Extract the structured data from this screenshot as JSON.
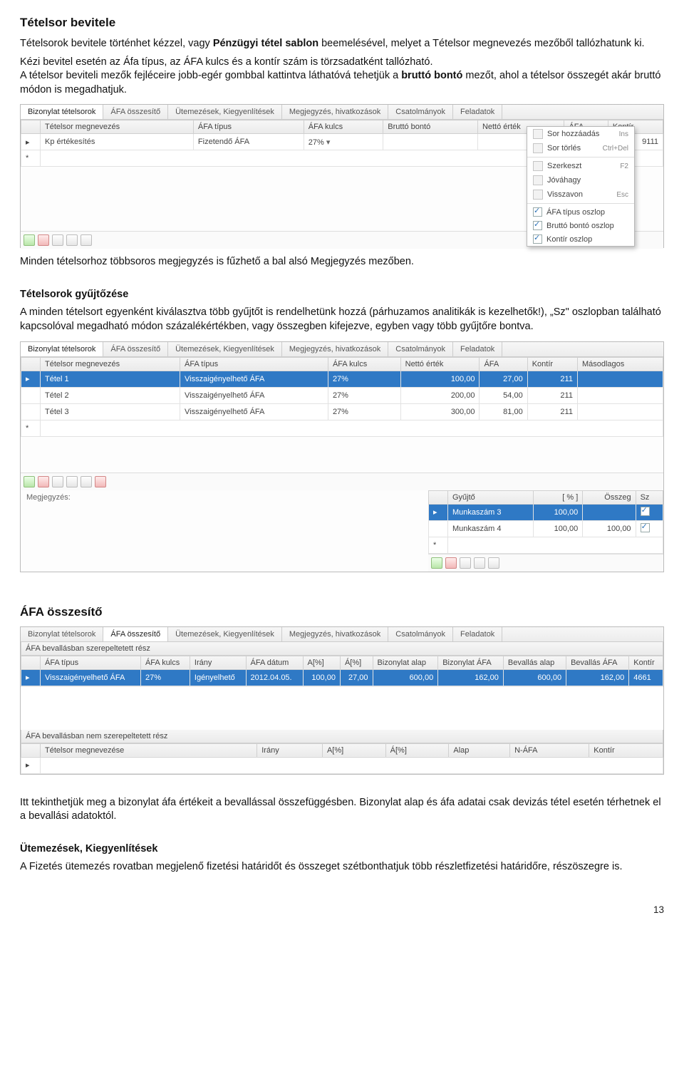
{
  "s0": {
    "h": "Tételsor bevitele",
    "p1a": "Tételsorok bevitele történhet kézzel, vagy ",
    "p1b": "Pénzügyi tétel sablon",
    "p1c": " beemelésével, melyet a Tételsor megnevezés mezőből tallózhatunk ki.",
    "p2a": "Kézi bevitel esetén az Áfa típus, az ÁFA kulcs és a kontír szám is törzsadatként tallózható.",
    "p2b": "A tételsor beviteli mezők fejléceire jobb-egér gombbal kattintva láthatóvá tehetjük a ",
    "p2c": "bruttó bontó",
    "p2d": " mezőt, ahol a tételsor összegét akár bruttó módon is megadhatjuk."
  },
  "shot1": {
    "tabs": [
      "Bizonylat tételsorok",
      "ÁFA összesítő",
      "Ütemezések, Kiegyenlítések",
      "Megjegyzés, hivatkozások",
      "Csatolmányok",
      "Feladatok"
    ],
    "cols": [
      "",
      "Tételsor megnevezés",
      "ÁFA típus",
      "ÁFA kulcs",
      "Bruttó bontó",
      "Nettó érték",
      "ÁFA",
      "Kontír"
    ],
    "row": {
      "name": "Kp értékesítés",
      "afat": "Fizetendő ÁFA",
      "kulcs": "27%",
      "kontir": "9111"
    },
    "ctx": [
      {
        "t": "Sor hozzáadás",
        "k": "Ins"
      },
      {
        "t": "Sor törlés",
        "k": "Ctrl+Del"
      },
      {
        "div": true
      },
      {
        "t": "Szerkeszt",
        "k": "F2"
      },
      {
        "t": "Jóváhagy",
        "k": ""
      },
      {
        "t": "Visszavon",
        "k": "Esc"
      },
      {
        "div": true
      },
      {
        "t": "ÁFA típus oszlop",
        "chk": true
      },
      {
        "t": "Bruttó bontó oszlop",
        "chk": true
      },
      {
        "t": "Kontír oszlop",
        "chk": true
      }
    ]
  },
  "s1": {
    "after": "Minden tételsorhoz többsoros megjegyzés is fűzhető a bal alsó Megjegyzés mezőben."
  },
  "s2": {
    "h": "Tételsorok gyűjtőzése",
    "p": "A minden tételsort egyenként kiválasztva több gyűjtőt is rendelhetünk hozzá (párhuzamos analitikák is kezelhetők!), „Sz\" oszlopban található kapcsolóval megadható módon százalékértékben, vagy összegben kifejezve, egyben vagy több gyűjtőre bontva."
  },
  "shot2": {
    "tabs": [
      "Bizonylat tételsorok",
      "ÁFA összesítő",
      "Ütemezések, Kiegyenlítések",
      "Megjegyzés, hivatkozások",
      "Csatolmányok",
      "Feladatok"
    ],
    "cols": [
      "",
      "Tételsor megnevezés",
      "ÁFA típus",
      "ÁFA kulcs",
      "Nettó érték",
      "ÁFA",
      "Kontír",
      "Másodlagos"
    ],
    "rows": [
      {
        "n": "Tétel 1",
        "t": "Visszaigényelhető ÁFA",
        "k": "27%",
        "ne": "100,00",
        "a": "27,00",
        "ko": "211",
        "sel": true
      },
      {
        "n": "Tétel 2",
        "t": "Visszaigényelhető ÁFA",
        "k": "27%",
        "ne": "200,00",
        "a": "54,00",
        "ko": "211"
      },
      {
        "n": "Tétel 3",
        "t": "Visszaigényelhető ÁFA",
        "k": "27%",
        "ne": "300,00",
        "a": "81,00",
        "ko": "211"
      }
    ],
    "meglbl": "Megjegyzés:",
    "gy": {
      "h": "Gyűjtő",
      "c2": "[ % ]",
      "c3": "Összeg",
      "c4": "Sz",
      "rows": [
        {
          "g": "Munkaszám 3",
          "p": "100,00",
          "o": ""
        },
        {
          "g": "Munkaszám 4",
          "p": "100,00",
          "o": "100,00"
        }
      ]
    }
  },
  "s3": {
    "h": "ÁFA összesítő"
  },
  "shot3": {
    "tabs": [
      "Bizonylat tételsorok",
      "ÁFA összesítő",
      "Ütemezések, Kiegyenlítések",
      "Megjegyzés, hivatkozások",
      "Csatolmányok",
      "Feladatok"
    ],
    "sub1": "ÁFA bevallásban szerepeltetett rész",
    "cols1": [
      "",
      "ÁFA típus",
      "ÁFA kulcs",
      "Irány",
      "ÁFA dátum",
      "A[%]",
      "Á[%]",
      "Bizonylat alap",
      "Bizonylat ÁFA",
      "Bevallás alap",
      "Bevallás ÁFA",
      "Kontír"
    ],
    "row1": {
      "t": "Visszaigényelhető ÁFA",
      "k": "27%",
      "ir": "Igényelhető",
      "d": "2012.04.05.",
      "ap": "100,00",
      "ap2": "27,00",
      "ba": "600,00",
      "bfa": "162,00",
      "bea": "600,00",
      "befa": "162,00",
      "ko": "4661"
    },
    "sub2": "ÁFA bevallásban nem szerepeltetett rész",
    "cols2": [
      "",
      "Tételsor megnevezése",
      "Irány",
      "A[%]",
      "Á[%]",
      "Alap",
      "N-ÁFA",
      "Kontír"
    ]
  },
  "s4": {
    "p": "Itt tekinthetjük meg a bizonylat áfa értékeit a bevallással összefüggésben. Bizonylat alap és áfa adatai csak devizás tétel esetén térhetnek el a bevallási adatoktól."
  },
  "s5": {
    "h": "Ütemezések, Kiegyenlítések",
    "p": "A Fizetés ütemezés rovatban megjelenő fizetési határidőt és összeget szétbonthatjuk több részletfizetési határidőre,  részöszegre  is."
  },
  "pageno": "13"
}
